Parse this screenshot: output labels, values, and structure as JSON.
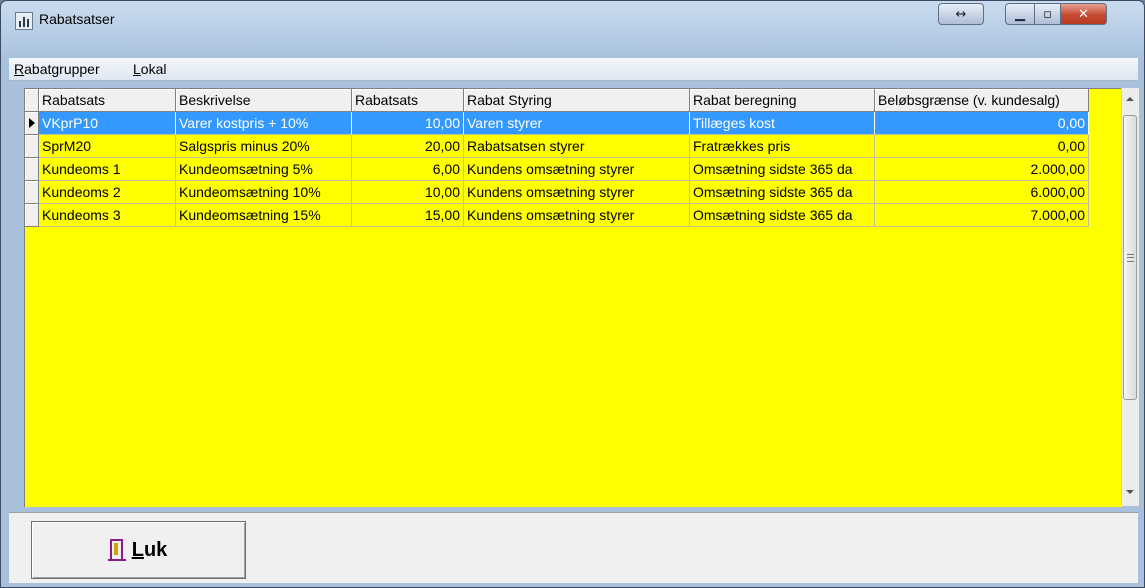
{
  "window": {
    "title": "Rabatsatser",
    "icons": {
      "app": "bar-chart-icon",
      "resize": "resize-horizontal-icon",
      "minimize": "minimize-icon",
      "maximize": "maximize-icon",
      "close": "close-icon"
    },
    "glyphs": {
      "resize": "↔",
      "minimize": "▁",
      "maximize": "▫",
      "close": "✕"
    }
  },
  "menu": {
    "items": [
      "Rabatgrupper",
      "Lokal"
    ]
  },
  "grid": {
    "columns": [
      "Rabatsats",
      "Beskrivelse",
      "Rabatsats",
      "Rabat Styring",
      "Rabat beregning",
      "Beløbsgrænse (v. kundesalg)"
    ],
    "rows": [
      [
        "VKprP10",
        "Varer kostpris + 10%",
        "10,00",
        "Varen styrer",
        "Tillæges kost",
        "0,00"
      ],
      [
        "SprM20",
        "Salgspris minus 20%",
        "20,00",
        "Rabatsatsen styrer",
        "Fratrækkes pris",
        "0,00"
      ],
      [
        "Kundeoms 1",
        "Kundeomsætning 5%",
        "6,00",
        "Kundens omsætning styrer",
        "Omsætning sidste 365 da",
        "2.000,00"
      ],
      [
        "Kundeoms 2",
        "Kundeomsætning 10%",
        "10,00",
        "Kundens omsætning styrer",
        "Omsætning sidste 365 da",
        "6.000,00"
      ],
      [
        "Kundeoms 3",
        "Kundeomsætning 15%",
        "15,00",
        "Kundens omsætning styrer",
        "Omsætning sidste 365 da",
        "7.000,00"
      ]
    ],
    "selected_row": 0,
    "colors": {
      "background": "#ffff00",
      "selection": "#3399ff"
    }
  },
  "footer": {
    "close_label": "Luk",
    "close_icon": "door-exit-icon"
  }
}
